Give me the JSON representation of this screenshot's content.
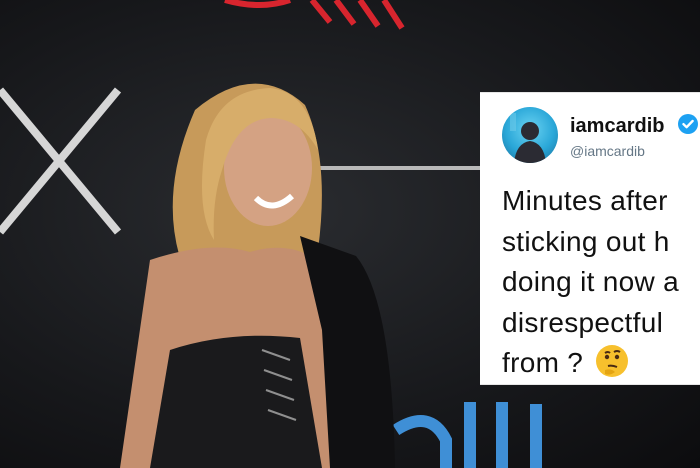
{
  "tweet": {
    "display_name": "iamcardib",
    "handle": "@iamcardib",
    "verified_icon": "verified-badge-icon",
    "lines": [
      "Minutes after",
      "sticking out h",
      "doing it now a",
      "disrespectful",
      "from ?"
    ],
    "emoji": "thinking-face-icon"
  },
  "colors": {
    "verified": "#1da1f2",
    "backdrop": "#141416",
    "logo_red": "#d8252e",
    "logo_blue": "#3f8fd6"
  }
}
